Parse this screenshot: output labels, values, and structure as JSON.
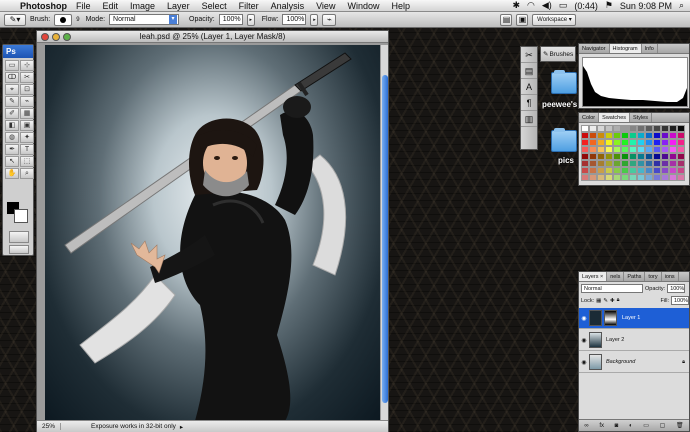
{
  "menubar": {
    "apple": "",
    "app_name": "Photoshop",
    "items": [
      "File",
      "Edit",
      "Image",
      "Layer",
      "Select",
      "Filter",
      "Analysis",
      "View",
      "Window",
      "Help"
    ],
    "battery": "(0:44)",
    "clock": "Sun 9:08 PM"
  },
  "options_bar": {
    "brush_label": "Brush:",
    "brush_size": "9",
    "mode_label": "Mode:",
    "mode_value": "Normal",
    "opacity_label": "Opacity:",
    "opacity_value": "100%",
    "flow_label": "Flow:",
    "flow_value": "100%",
    "workspace_label": "Workspace"
  },
  "tools": {
    "header": "Ps",
    "items": [
      "▭",
      "⊹",
      "ↀ",
      "✂",
      "⌖",
      "⊡",
      "✎",
      "⌁",
      "✐",
      "▦",
      "◧",
      "▣",
      "◍",
      "✦",
      "✒",
      "T",
      "↖",
      "⬚",
      "✋",
      "⌕"
    ]
  },
  "document": {
    "title": "leah.psd @ 25% (Layer 1, Layer Mask/8)",
    "zoom": "25%",
    "status": "Exposure works in 32-bit only"
  },
  "side_panel": {
    "brushes_label": "Brushes"
  },
  "desktop": {
    "folders": [
      "peewee's",
      "pics"
    ]
  },
  "navigator": {
    "tabs": [
      "Navigator",
      "Histogram",
      "Info"
    ],
    "active_tab": "Histogram"
  },
  "swatches_panel": {
    "tabs": [
      "Color",
      "Swatches",
      "Styles"
    ],
    "active_tab": "Swatches"
  },
  "layers_panel": {
    "tabs": [
      "Layers",
      "Channels",
      "Paths",
      "History",
      "Actions"
    ],
    "tab_display": [
      "Layers ×",
      "nels",
      "Paths",
      "tory",
      "ions"
    ],
    "blend_mode": "Normal",
    "opacity_label": "Opacity:",
    "opacity_value": "100%",
    "lock_label": "Lock:",
    "fill_label": "Fill:",
    "fill_value": "100%",
    "layers": [
      {
        "name": "Layer 1",
        "selected": true
      },
      {
        "name": "Layer 2",
        "selected": false
      },
      {
        "name": "Background",
        "selected": false
      }
    ],
    "footer_icons": [
      "link-icon",
      "fx-icon",
      "mask-icon",
      "adjustment-icon",
      "folder-icon",
      "new-layer-icon",
      "trash-icon"
    ]
  },
  "colors": {
    "selection_blue": "#1e5fd6",
    "foreground": "#000000",
    "background": "#ffffff"
  }
}
